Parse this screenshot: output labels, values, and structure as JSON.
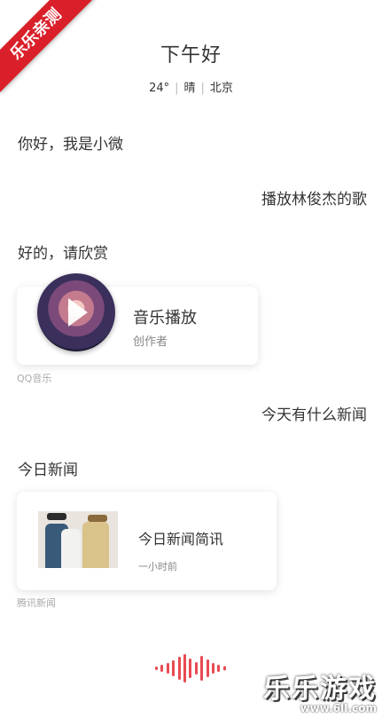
{
  "corner_banner": "乐乐亲测",
  "header": {
    "greeting": "下午好",
    "temperature": "24°",
    "condition": "晴",
    "city": "北京"
  },
  "messages": [
    {
      "side": "left",
      "text": "你好，我是小微"
    },
    {
      "side": "right",
      "text": "播放林俊杰的歌"
    },
    {
      "side": "left",
      "text": "好的，请欣赏"
    },
    {
      "side": "right",
      "text": "今天有什么新闻"
    },
    {
      "side": "left",
      "text": "今日新闻"
    }
  ],
  "music_card": {
    "title": "音乐播放",
    "subtitle": "创作者",
    "source": "QQ音乐",
    "icon": "play-icon"
  },
  "news_card": {
    "title": "今日新闻简讯",
    "time": "一小时前",
    "source": "腾讯新闻"
  },
  "voice_icon": "voice-wave-icon",
  "accent_color": "#e84a53",
  "watermark": {
    "main": "乐乐游戏",
    "url": "www.6lI.com"
  }
}
